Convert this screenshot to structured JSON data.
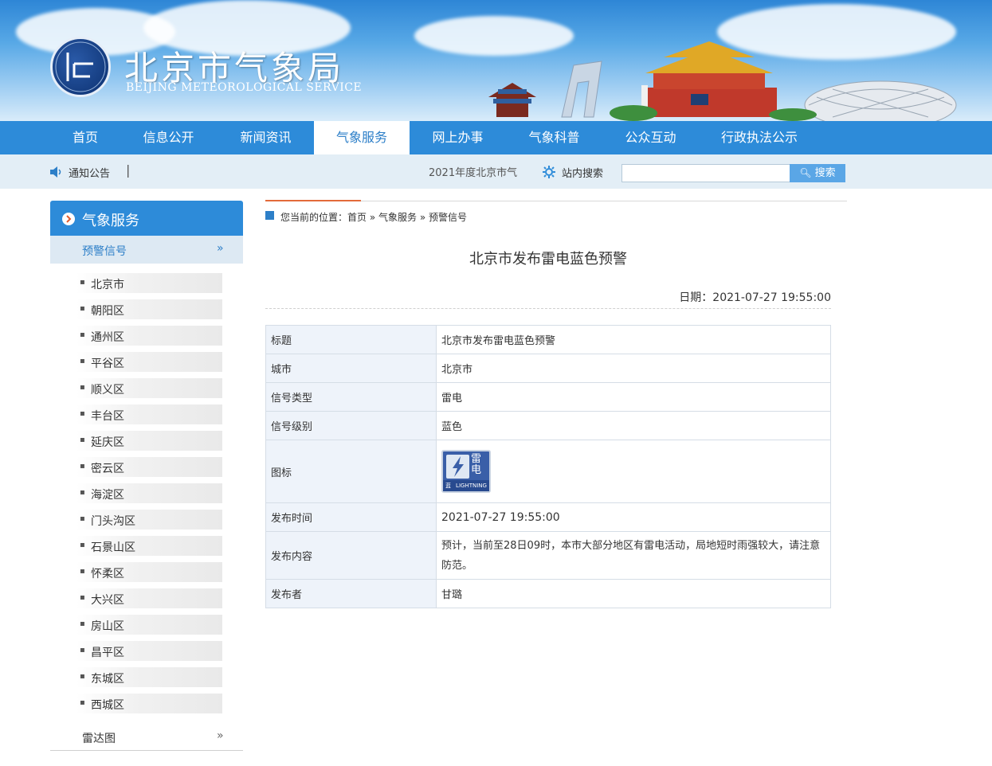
{
  "header": {
    "title": "北京市气象局",
    "subtitle": "BEIJING METEOROLOGICAL SERVICE",
    "logo_text": "BEIJING METEOROLOGICAL SERVICE"
  },
  "nav": {
    "items": [
      "首页",
      "信息公开",
      "新闻资讯",
      "气象服务",
      "网上办事",
      "气象科普",
      "公众互动",
      "行政执法公示"
    ],
    "active": "气象服务"
  },
  "notice": {
    "label": "通知公告",
    "separator": "|",
    "marquee": "2021年度北京市气",
    "search_label": "站内搜索",
    "search_button": "搜索",
    "search_value": ""
  },
  "sidebar": {
    "title": "气象服务",
    "sub": "预警信号",
    "sub_arrow": "»",
    "districts": [
      "北京市",
      "朝阳区",
      "通州区",
      "平谷区",
      "顺义区",
      "丰台区",
      "延庆区",
      "密云区",
      "海淀区",
      "门头沟区",
      "石景山区",
      "怀柔区",
      "大兴区",
      "房山区",
      "昌平区",
      "东城区",
      "西城区"
    ],
    "radar": "雷达图",
    "radar_arrow": "»"
  },
  "breadcrumb": {
    "prefix": "您当前的位置：",
    "items": [
      "首页",
      "气象服务",
      "预警信号"
    ],
    "sep": "»"
  },
  "article": {
    "title": "北京市发布雷电蓝色预警",
    "date": "日期：2021-07-27 19:55:00"
  },
  "table": {
    "rows": [
      {
        "key": "标题",
        "value": "北京市发布雷电蓝色预警"
      },
      {
        "key": "城市",
        "value": "北京市"
      },
      {
        "key": "信号类型",
        "value": "雷电"
      },
      {
        "key": "信号级别",
        "value": "蓝色"
      },
      {
        "key": "图标",
        "value": ""
      },
      {
        "key": "发布时间",
        "value": "2021-07-27 19:55:00"
      },
      {
        "key": "发布内容",
        "value": "预计，当前至28日09时，本市大部分地区有雷电活动，局地短时雨强较大，请注意防范。"
      },
      {
        "key": "发布者",
        "value": "甘璐"
      }
    ],
    "icon": {
      "top_text": "雷电",
      "bottom_text": "LIGHTNING",
      "small_text": "蓝",
      "color": "#3a5fa8"
    }
  },
  "colors": {
    "nav": "#2d8bd9",
    "accent": "#2d7fc8",
    "banner_top": "#2e86d6"
  }
}
